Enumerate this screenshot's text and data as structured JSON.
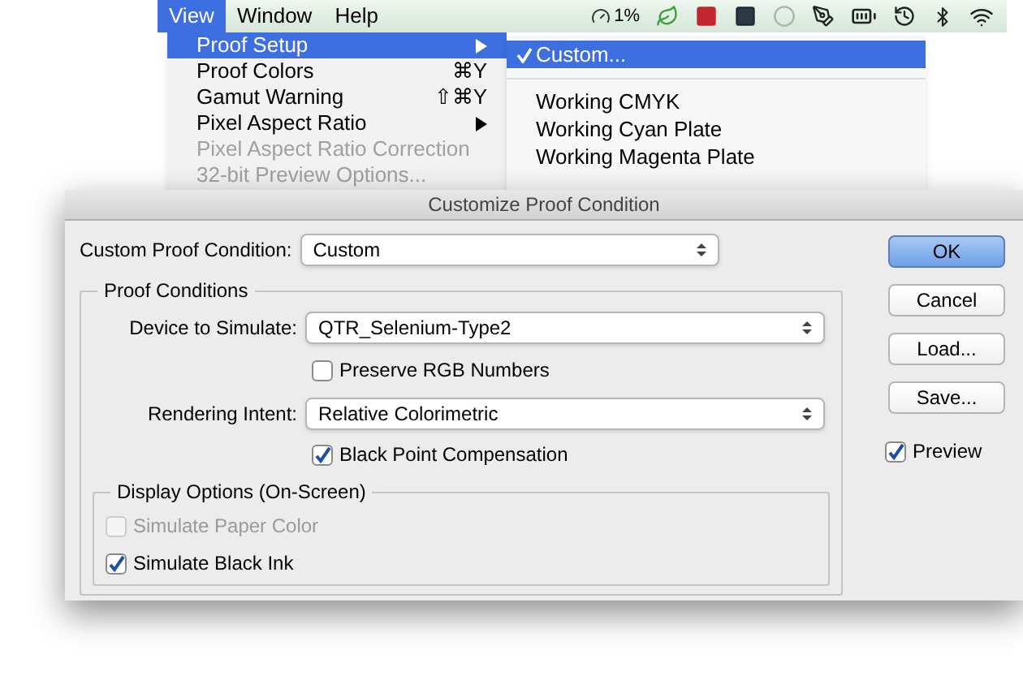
{
  "menubar": {
    "menus": [
      {
        "label": "View",
        "selected": true
      },
      {
        "label": "Window",
        "selected": false
      },
      {
        "label": "Help",
        "selected": false
      }
    ],
    "cpu_reading": "1%"
  },
  "view_menu": {
    "items": [
      {
        "label": "Proof Setup",
        "submenu": true,
        "disabled": false,
        "selected": true
      },
      {
        "label": "Proof Colors",
        "shortcut": "⌘Y",
        "submenu": false,
        "disabled": false,
        "selected": false
      },
      {
        "label": "Gamut Warning",
        "shortcut": "⇧⌘Y",
        "submenu": false,
        "disabled": false,
        "selected": false
      },
      {
        "label": "Pixel Aspect Ratio",
        "submenu": true,
        "disabled": false,
        "selected": false
      },
      {
        "label": "Pixel Aspect Ratio Correction",
        "submenu": false,
        "disabled": true,
        "selected": false
      },
      {
        "label": "32-bit Preview Options...",
        "submenu": false,
        "disabled": true,
        "selected": false
      }
    ]
  },
  "proof_setup_menu": {
    "items": [
      {
        "kind": "item",
        "label": "Custom...",
        "checked": true,
        "selected": true
      },
      {
        "kind": "separator"
      },
      {
        "kind": "item",
        "label": "Working CMYK",
        "checked": false,
        "selected": false
      },
      {
        "kind": "item",
        "label": "Working Cyan Plate",
        "checked": false,
        "selected": false
      },
      {
        "kind": "item",
        "label": "Working Magenta Plate",
        "checked": false,
        "selected": false
      }
    ]
  },
  "dialog": {
    "title": "Customize Proof Condition",
    "custom_condition": {
      "label": "Custom Proof Condition:",
      "value": "Custom"
    },
    "proof_conditions": {
      "title": "Proof Conditions",
      "device": {
        "label": "Device to Simulate:",
        "value": "QTR_Selenium-Type2"
      },
      "preserve_rgb": {
        "label": "Preserve RGB Numbers",
        "checked": false,
        "disabled": false
      },
      "rendering_intent": {
        "label": "Rendering Intent:",
        "value": "Relative Colorimetric"
      },
      "black_point": {
        "label": "Black Point Compensation",
        "checked": true,
        "disabled": false
      },
      "display_options": {
        "title": "Display Options (On-Screen)",
        "options": [
          {
            "label": "Simulate Paper Color",
            "checked": false,
            "disabled": true
          },
          {
            "label": "Simulate Black Ink",
            "checked": true,
            "disabled": false
          }
        ]
      }
    },
    "buttons": [
      {
        "label": "OK",
        "default": true
      },
      {
        "label": "Cancel",
        "default": false
      },
      {
        "label": "Load...",
        "default": false
      },
      {
        "label": "Save...",
        "default": false
      }
    ],
    "preview": {
      "label": "Preview",
      "checked": true,
      "disabled": false
    }
  }
}
